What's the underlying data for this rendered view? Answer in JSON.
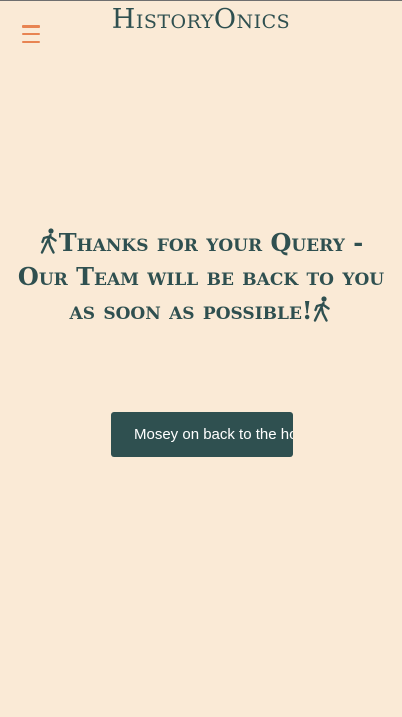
{
  "header": {
    "brand": "HistoryOnics",
    "menu_icon": "hamburger-menu-icon"
  },
  "main": {
    "message": "Thanks for your Query - Our Team will be back to you as soon as possible!",
    "message_icon": "walking-person-icon",
    "back_button_label": "Mosey on back to the home page"
  },
  "colors": {
    "background": "#faead6",
    "text": "#2f5050",
    "accent": "#e88452",
    "button_bg": "#2f5050",
    "button_text": "#ffffff"
  }
}
